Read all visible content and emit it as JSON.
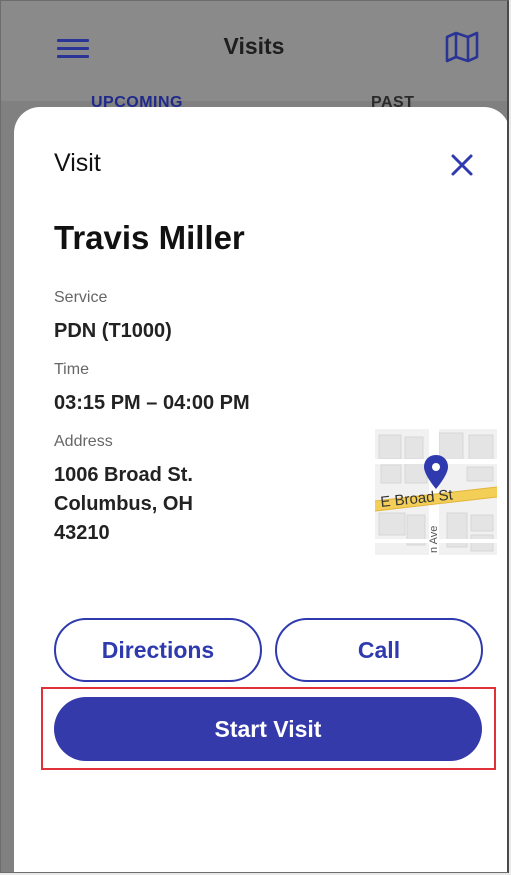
{
  "app_bar": {
    "title": "Visits",
    "menu_icon": "hamburger-menu-icon",
    "map_icon": "map-icon"
  },
  "tabs": {
    "upcoming_label": "UPCOMING",
    "past_label": "PAST"
  },
  "sheet": {
    "title": "Visit",
    "close_icon": "close-icon",
    "patient_name": "Travis Miller",
    "service_label": "Service",
    "service_value": "PDN (T1000)",
    "time_label": "Time",
    "time_value": "03:15 PM – 04:00 PM",
    "address_label": "Address",
    "address_lines": [
      "1006 Broad St.",
      "Columbus, OH",
      "43210"
    ],
    "map": {
      "street_label": "E Broad St",
      "cross_street_label": "n Ave",
      "pin_icon": "map-pin-icon"
    },
    "directions_label": "Directions",
    "call_label": "Call",
    "start_visit_label": "Start Visit"
  },
  "colors": {
    "primary": "#343aa9",
    "highlight": "#e0303a",
    "overlay": "#808080"
  }
}
